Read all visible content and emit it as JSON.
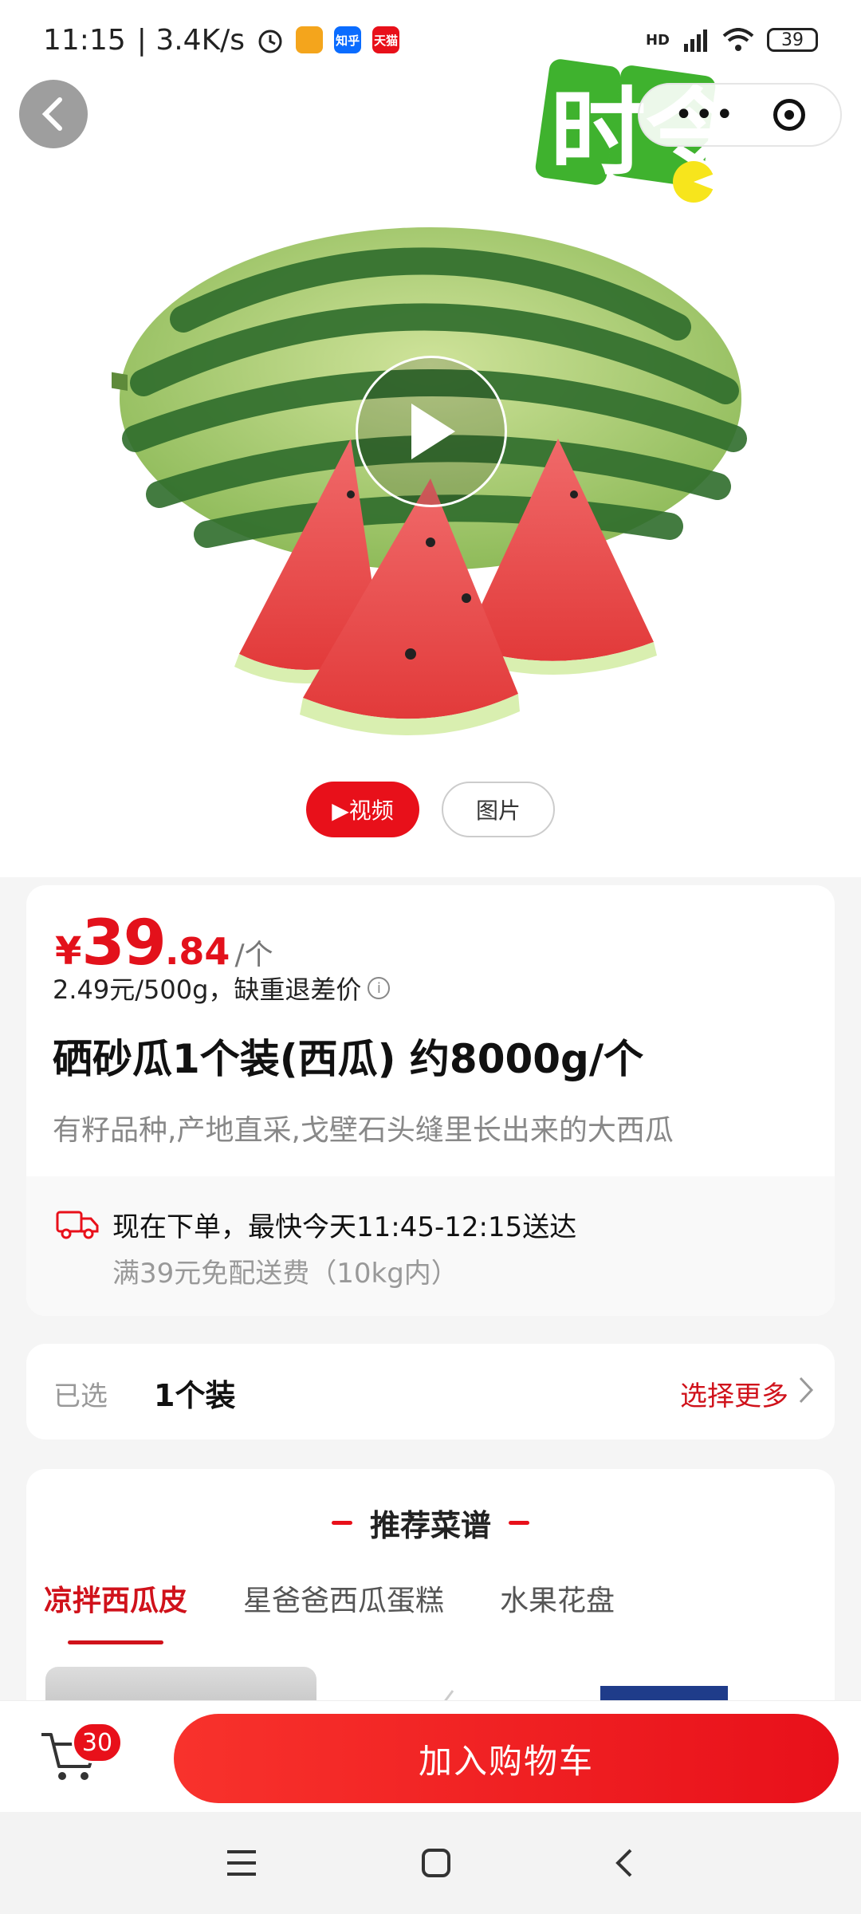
{
  "status_bar": {
    "time": "11:15",
    "network_speed": "| 3.4K/s",
    "apps": [
      {
        "icon": "alarm-icon"
      },
      {
        "icon": "app-icon-orange"
      },
      {
        "label": "知乎",
        "color": "#0a6cff"
      },
      {
        "label": "天猫",
        "color": "#e8101a"
      }
    ],
    "hd_label": "HD",
    "battery": "39"
  },
  "hero": {
    "logo_text": "时令",
    "play_icon": "play-icon"
  },
  "media_tabs": {
    "video": "▶视频",
    "image": "图片"
  },
  "product": {
    "currency": "¥",
    "price_int": "39",
    "price_dec": ".84",
    "price_unit": "/个",
    "unit_price": "2.49元/500g，缺重退差价",
    "title": "硒砂瓜1个装(西瓜) 约8000g/个",
    "subtitle": "有籽品种,产地直采,戈壁石头缝里长出来的大西瓜"
  },
  "delivery": {
    "main": "现在下单，最快今天11:45-12:15送达",
    "sub": "满39元免配送费（10kg内）"
  },
  "spec": {
    "label": "已选",
    "value": "1个装",
    "more": "选择更多"
  },
  "recipes": {
    "title": "推荐菜谱",
    "tabs": [
      "凉拌西瓜皮",
      "星爸爸西瓜蛋糕",
      "水果花盘"
    ]
  },
  "bottom_bar": {
    "cart_count": "30",
    "add_to_cart": "加入购物车"
  },
  "colors": {
    "accent": "#e8101a",
    "accent_text": "#d0121b"
  }
}
